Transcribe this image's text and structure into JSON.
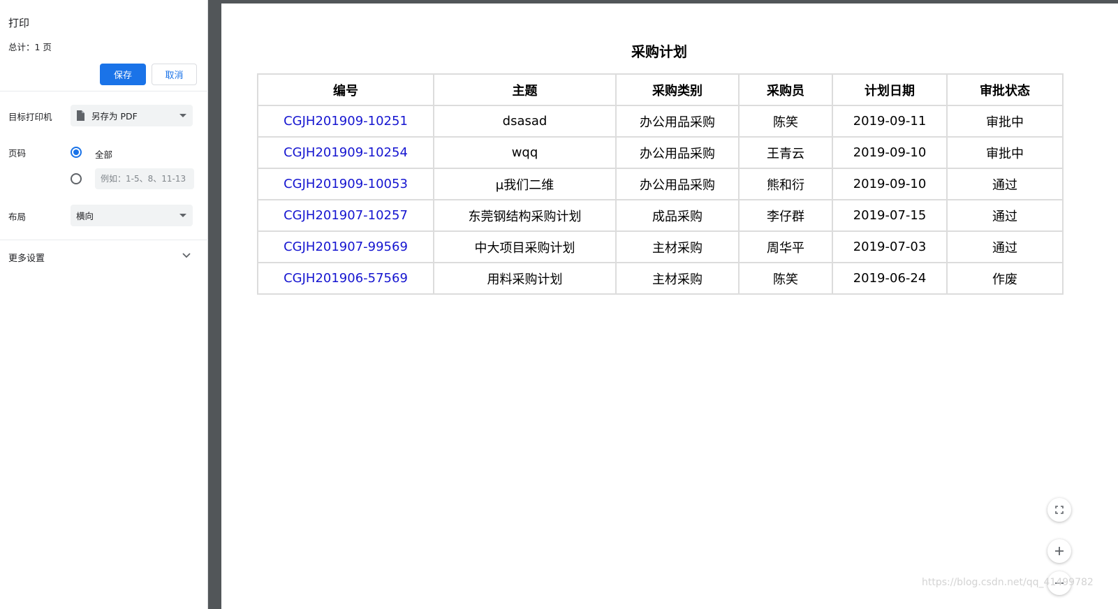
{
  "sidebar": {
    "title": "打印",
    "total_pages": "总计：1 页",
    "save_label": "保存",
    "cancel_label": "取消",
    "printer": {
      "label": "目标打印机",
      "value": "另存为 PDF"
    },
    "pages": {
      "label": "页码",
      "all_label": "全部",
      "custom_placeholder": "例如：1-5、8、11-13"
    },
    "layout": {
      "label": "布局",
      "value": "横向"
    },
    "more_settings_label": "更多设置"
  },
  "document": {
    "title": "采购计划",
    "headers": [
      "编号",
      "主题",
      "采购类别",
      "采购员",
      "计划日期",
      "审批状态"
    ],
    "rows": [
      [
        "CGJH201909-10251",
        "dsasad",
        "办公用品采购",
        "陈笑",
        "2019-09-11",
        "审批中"
      ],
      [
        "CGJH201909-10254",
        "wqq",
        "办公用品采购",
        "王青云",
        "2019-09-10",
        "审批中"
      ],
      [
        "CGJH201909-10053",
        "μ我们二维",
        "办公用品采购",
        "熊和衍",
        "2019-09-10",
        "通过"
      ],
      [
        "CGJH201907-10257",
        "东莞钢结构采购计划",
        "成品采购",
        "李仔群",
        "2019-07-15",
        "通过"
      ],
      [
        "CGJH201907-99569",
        "中大项目采购计划",
        "主材采购",
        "周华平",
        "2019-07-03",
        "通过"
      ],
      [
        "CGJH201906-57569",
        "用料采购计划",
        "主材采购",
        "陈笑",
        "2019-06-24",
        "作废"
      ]
    ]
  },
  "watermark": "https://blog.csdn.net/qq_41499782",
  "colors": {
    "accent": "#1a73e8",
    "link": "#1515d0",
    "viewer_bg": "#525659"
  },
  "icons": [
    "document-icon",
    "dropdown-caret-icon",
    "chevron-down-icon",
    "fit-to-page-icon",
    "zoom-in-icon",
    "zoom-out-icon"
  ]
}
